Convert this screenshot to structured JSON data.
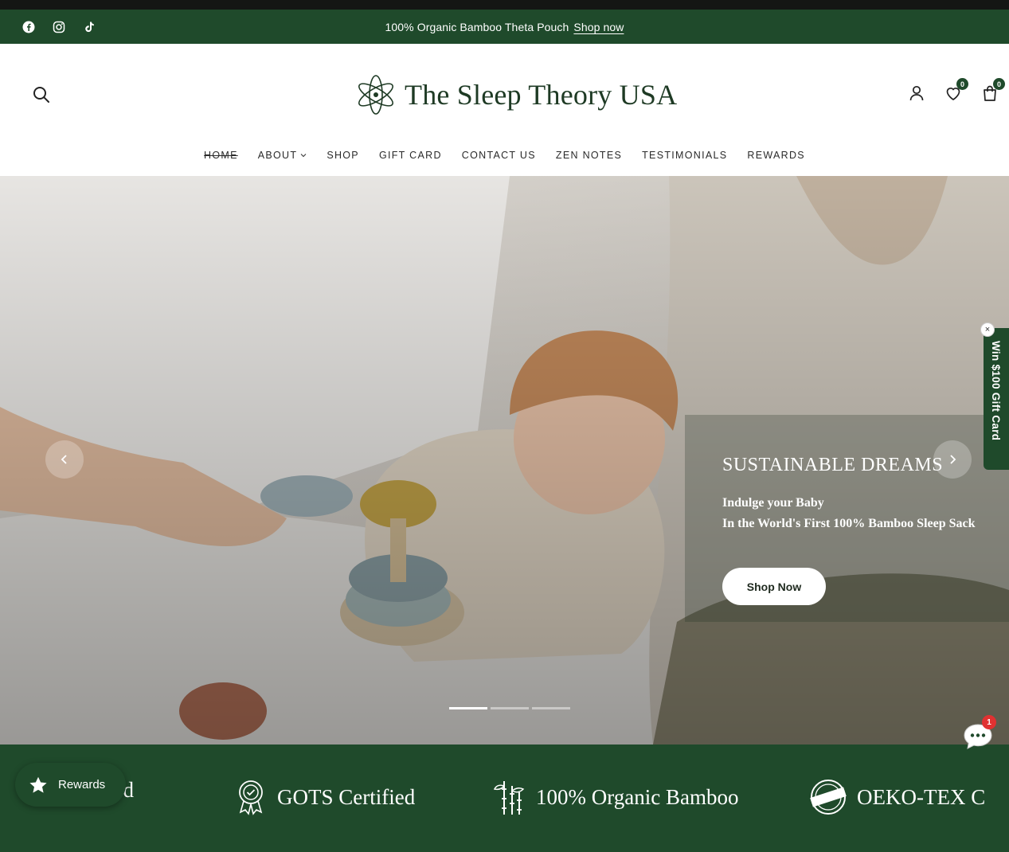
{
  "announcement": {
    "text": "100% Organic Bamboo Theta Pouch",
    "link_label": "Shop now"
  },
  "social": [
    "facebook-icon",
    "instagram-icon",
    "tiktok-icon"
  ],
  "header": {
    "logo_text": "The Sleep Theory USA",
    "wishlist_count": "0",
    "cart_count": "0"
  },
  "nav": {
    "items": [
      {
        "label": "HOME"
      },
      {
        "label": "ABOUT"
      },
      {
        "label": "SHOP"
      },
      {
        "label": "GIFT CARD"
      },
      {
        "label": "CONTACT US"
      },
      {
        "label": "ZEN NOTES"
      },
      {
        "label": "TESTIMONIALS"
      },
      {
        "label": "REWARDS"
      }
    ]
  },
  "hero": {
    "title": "SUSTAINABLE DREAMS",
    "subtitle_line1": "Indulge your Baby",
    "subtitle_line2": "In the World's First 100% Bamboo Sleep Sack",
    "cta_label": "Shop Now",
    "slide_count": 3,
    "active_slide": 1
  },
  "gift_tab": {
    "label": "Win $100 Gift Card",
    "close": "×"
  },
  "chat": {
    "badge_count": "1"
  },
  "rewards": {
    "label": "Rewards"
  },
  "features": {
    "items": [
      {
        "label": "ased"
      },
      {
        "label": "GOTS Certified"
      },
      {
        "label": "100% Organic Bamboo"
      },
      {
        "label": "OEKO-TEX C"
      }
    ]
  },
  "colors": {
    "brand_green": "#1f4a2b",
    "badge_red": "#e03131"
  }
}
